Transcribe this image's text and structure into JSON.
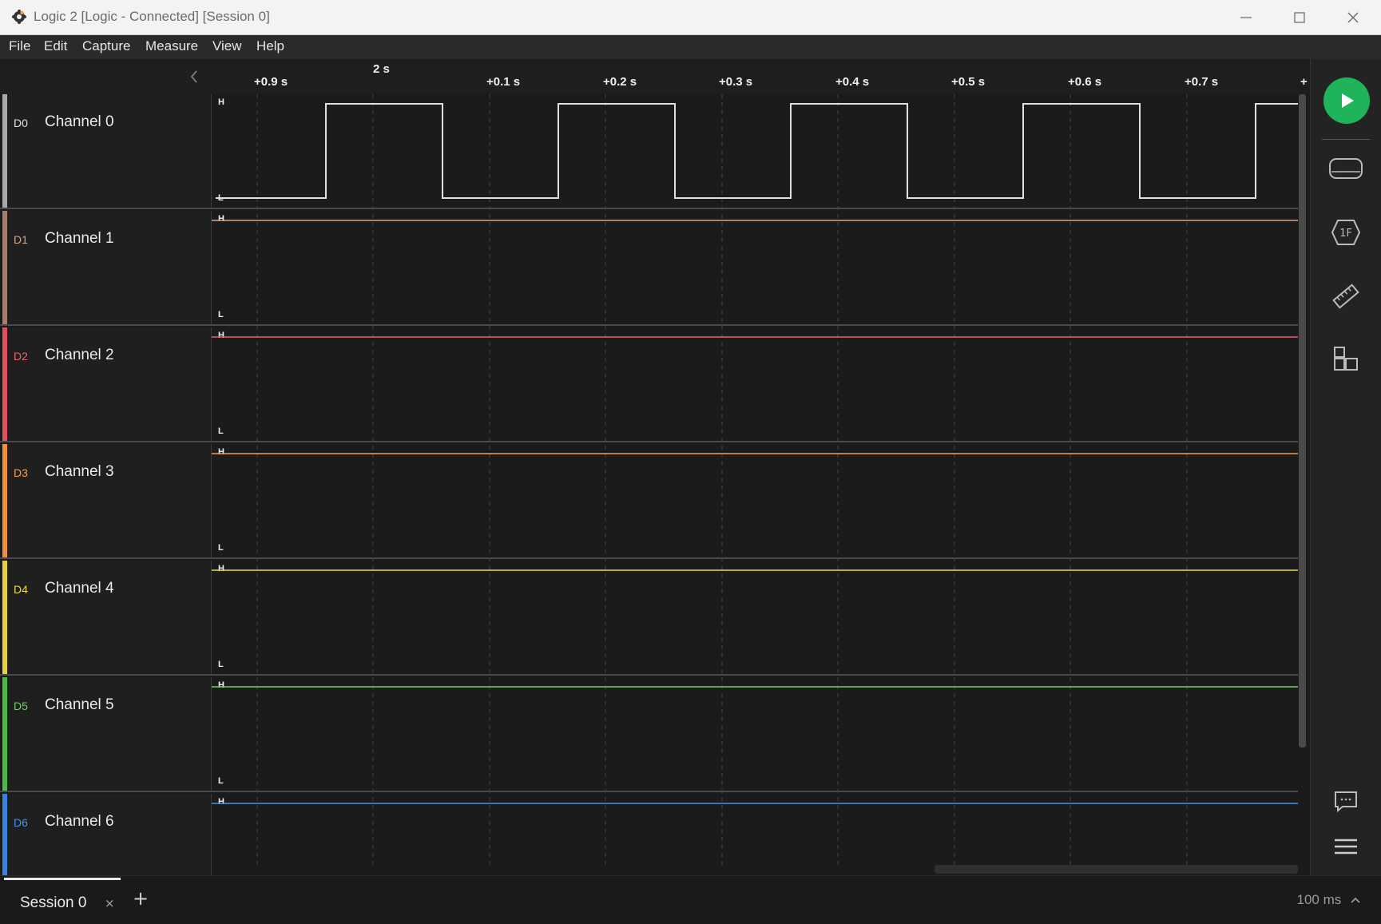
{
  "window": {
    "title": "Logic 2 [Logic - Connected] [Session 0]",
    "icons": [
      "app-gear-icon",
      "minimize-icon",
      "maximize-icon",
      "close-icon"
    ]
  },
  "menu": [
    "File",
    "Edit",
    "Capture",
    "Measure",
    "View",
    "Help"
  ],
  "timeline": {
    "major_label": "2 s",
    "ticks": [
      "+0.9 s",
      "+0.1 s",
      "+0.2 s",
      "+0.3 s",
      "+0.4 s",
      "+0.5 s",
      "+0.6 s",
      "+0.7 s",
      "+"
    ]
  },
  "channels": [
    {
      "id": "D0",
      "name": "Channel 0",
      "color": "#a8a8a8",
      "wave": "#e0e0e0"
    },
    {
      "id": "D1",
      "name": "Channel 1",
      "color": "#a57d6d",
      "wave": "#d9a488"
    },
    {
      "id": "D2",
      "name": "Channel 2",
      "color": "#e0505f",
      "wave": "#f06070"
    },
    {
      "id": "D3",
      "name": "Channel 3",
      "color": "#f0913a",
      "wave": "#f5a050"
    },
    {
      "id": "D4",
      "name": "Channel 4",
      "color": "#e6d23a",
      "wave": "#f0dc40"
    },
    {
      "id": "D5",
      "name": "Channel 5",
      "color": "#4cb848",
      "wave": "#6fcf6b"
    },
    {
      "id": "D6",
      "name": "Channel 6",
      "color": "#3b82e0",
      "wave": "#4a90f0"
    }
  ],
  "levels": {
    "high": "H",
    "low": "L"
  },
  "sidebar": {
    "icons": [
      "play-icon",
      "device-icon",
      "analyzer-icon",
      "measure-ruler-icon",
      "extensions-icon",
      "notes-icon",
      "menu-icon"
    ]
  },
  "bottom": {
    "tab": "Session 0",
    "tab_close": "×",
    "add": "+",
    "zoom": "100 ms"
  }
}
